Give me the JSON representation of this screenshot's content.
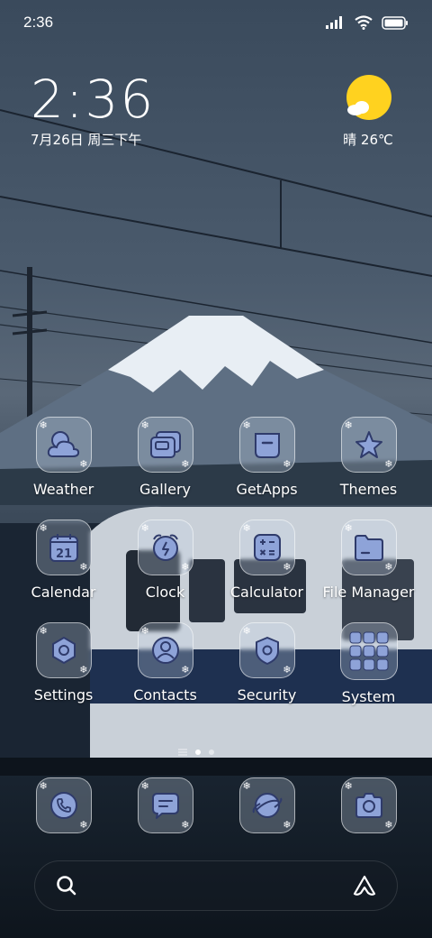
{
  "statusbar": {
    "time": "2:36"
  },
  "clock_widget": {
    "time": "2:36",
    "date": "7月26日 周三下午"
  },
  "weather_widget": {
    "text": "晴 26℃"
  },
  "apps": [
    {
      "label": "Weather",
      "icon": "weather-icon"
    },
    {
      "label": "Gallery",
      "icon": "gallery-icon"
    },
    {
      "label": "GetApps",
      "icon": "getapps-icon"
    },
    {
      "label": "Themes",
      "icon": "themes-icon"
    },
    {
      "label": "Calendar",
      "icon": "calendar-icon",
      "badge": "21"
    },
    {
      "label": "Clock",
      "icon": "clock-icon"
    },
    {
      "label": "Calculator",
      "icon": "calculator-icon"
    },
    {
      "label": "File Manager",
      "icon": "file-manager-icon"
    },
    {
      "label": "Settings",
      "icon": "settings-icon"
    },
    {
      "label": "Contacts",
      "icon": "contacts-icon"
    },
    {
      "label": "Security",
      "icon": "security-icon"
    },
    {
      "label": "System",
      "icon": "system-folder-icon"
    }
  ],
  "dock": [
    {
      "icon": "phone-icon"
    },
    {
      "icon": "messages-icon"
    },
    {
      "icon": "browser-icon"
    },
    {
      "icon": "camera-icon"
    }
  ],
  "page_indicator": {
    "pages": 2,
    "current": 1
  },
  "search": {
    "icon": "search-icon",
    "assistant_icon": "assistant-icon"
  },
  "colors": {
    "icon_fill": "#8ea3d8",
    "icon_stroke": "#2f3b6b",
    "sun": "#ffd21f"
  }
}
